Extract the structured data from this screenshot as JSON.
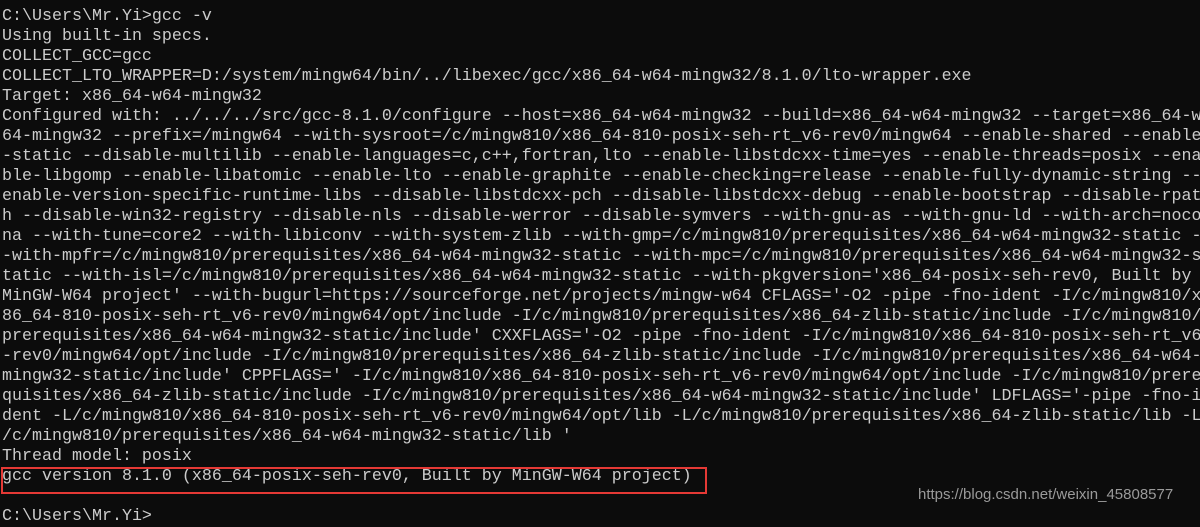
{
  "console": {
    "background": "#0c0c0c",
    "foreground": "#cccccc",
    "highlight_color": "#e53935",
    "lines": [
      "C:\\Users\\Mr.Yi>gcc -v",
      "Using built-in specs.",
      "COLLECT_GCC=gcc",
      "COLLECT_LTO_WRAPPER=D:/system/mingw64/bin/../libexec/gcc/x86_64-w64-mingw32/8.1.0/lto-wrapper.exe",
      "Target: x86_64-w64-mingw32",
      "Configured with: ../../../src/gcc-8.1.0/configure --host=x86_64-w64-mingw32 --build=x86_64-w64-mingw32 --target=x86_64-w",
      "64-mingw32 --prefix=/mingw64 --with-sysroot=/c/mingw810/x86_64-810-posix-seh-rt_v6-rev0/mingw64 --enable-shared --enable",
      "-static --disable-multilib --enable-languages=c,c++,fortran,lto --enable-libstdcxx-time=yes --enable-threads=posix --ena",
      "ble-libgomp --enable-libatomic --enable-lto --enable-graphite --enable-checking=release --enable-fully-dynamic-string --",
      "enable-version-specific-runtime-libs --disable-libstdcxx-pch --disable-libstdcxx-debug --enable-bootstrap --disable-rpat",
      "h --disable-win32-registry --disable-nls --disable-werror --disable-symvers --with-gnu-as --with-gnu-ld --with-arch=noco",
      "na --with-tune=core2 --with-libiconv --with-system-zlib --with-gmp=/c/mingw810/prerequisites/x86_64-w64-mingw32-static -",
      "-with-mpfr=/c/mingw810/prerequisites/x86_64-w64-mingw32-static --with-mpc=/c/mingw810/prerequisites/x86_64-w64-mingw32-s",
      "tatic --with-isl=/c/mingw810/prerequisites/x86_64-w64-mingw32-static --with-pkgversion='x86_64-posix-seh-rev0, Built by",
      "MinGW-W64 project' --with-bugurl=https://sourceforge.net/projects/mingw-w64 CFLAGS='-O2 -pipe -fno-ident -I/c/mingw810/x",
      "86_64-810-posix-seh-rt_v6-rev0/mingw64/opt/include -I/c/mingw810/prerequisites/x86_64-zlib-static/include -I/c/mingw810/",
      "prerequisites/x86_64-w64-mingw32-static/include' CXXFLAGS='-O2 -pipe -fno-ident -I/c/mingw810/x86_64-810-posix-seh-rt_v6",
      "-rev0/mingw64/opt/include -I/c/mingw810/prerequisites/x86_64-zlib-static/include -I/c/mingw810/prerequisites/x86_64-w64-",
      "mingw32-static/include' CPPFLAGS=' -I/c/mingw810/x86_64-810-posix-seh-rt_v6-rev0/mingw64/opt/include -I/c/mingw810/prere",
      "quisites/x86_64-zlib-static/include -I/c/mingw810/prerequisites/x86_64-w64-mingw32-static/include' LDFLAGS='-pipe -fno-i",
      "dent -L/c/mingw810/x86_64-810-posix-seh-rt_v6-rev0/mingw64/opt/lib -L/c/mingw810/prerequisites/x86_64-zlib-static/lib -L",
      "/c/mingw810/prerequisites/x86_64-w64-mingw32-static/lib '",
      "Thread model: posix",
      "gcc version 8.1.0 (x86_64-posix-seh-rev0, Built by MinGW-W64 project)",
      "",
      "C:\\Users\\Mr.Yi>"
    ]
  },
  "watermark": "https://blog.csdn.net/weixin_45808577"
}
